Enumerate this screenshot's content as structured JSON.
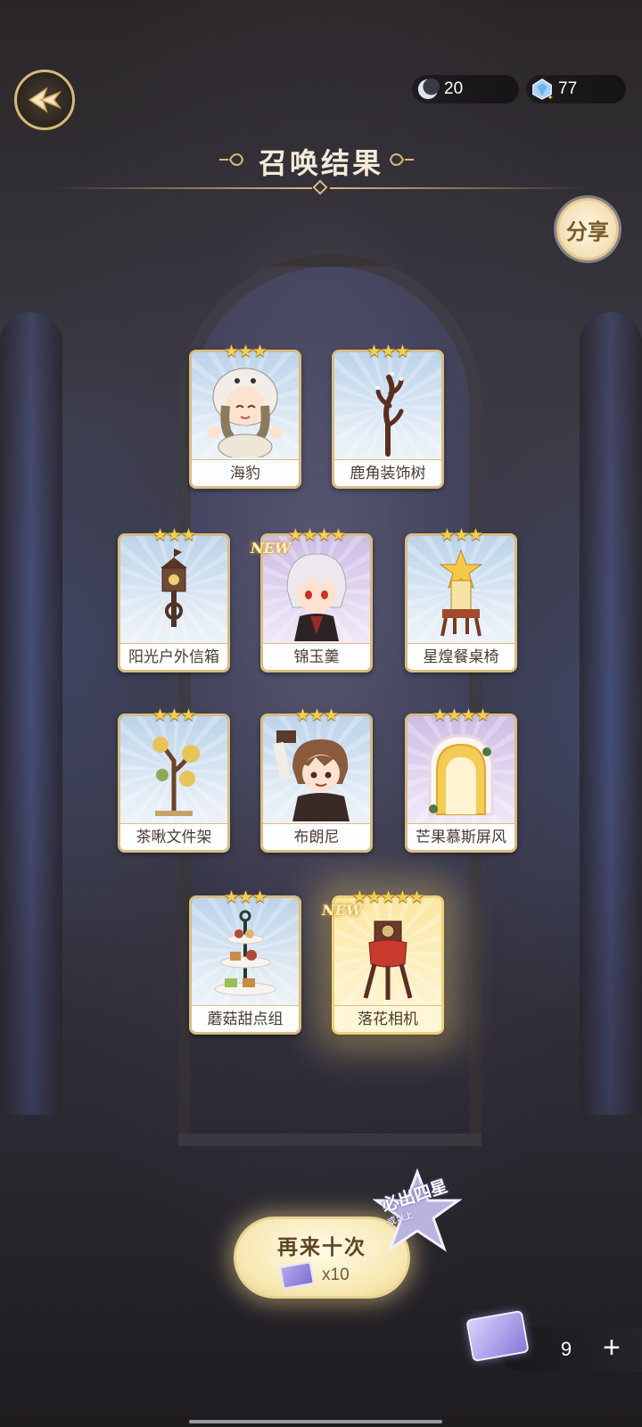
{
  "header": {
    "currencies": [
      {
        "icon": "moon-icon",
        "value": "20"
      },
      {
        "icon": "gem-icon",
        "value": "77"
      }
    ],
    "title": "召唤结果",
    "share_label": "分享"
  },
  "results": [
    {
      "name": "海豹",
      "stars": "★★★",
      "new": "",
      "theme": "blue",
      "art": "seal-character"
    },
    {
      "name": "鹿角装饰树",
      "stars": "★★★",
      "new": "",
      "theme": "blue",
      "art": "antler-tree"
    },
    {
      "name": "阳光户外信箱",
      "stars": "★★★",
      "new": "",
      "theme": "blue",
      "art": "mailbox"
    },
    {
      "name": "锦玉羹",
      "stars": "★★★★",
      "new": "NEW",
      "theme": "purple",
      "art": "white-hair-character"
    },
    {
      "name": "星煌餐桌椅",
      "stars": "★★★",
      "new": "",
      "theme": "blue",
      "art": "star-chair"
    },
    {
      "name": "茶啾文件架",
      "stars": "★★★",
      "new": "",
      "theme": "blue",
      "art": "file-rack-tree"
    },
    {
      "name": "布朗尼",
      "stars": "★★★",
      "new": "",
      "theme": "blue",
      "art": "brown-hair-character"
    },
    {
      "name": "芒果慕斯屏风",
      "stars": "★★★★",
      "new": "",
      "theme": "purple",
      "art": "mango-screen"
    },
    {
      "name": "蘑菇甜点组",
      "stars": "★★★",
      "new": "",
      "theme": "blue",
      "art": "dessert-stand"
    },
    {
      "name": "落花相机",
      "stars": "★★★★★",
      "new": "NEW",
      "theme": "gold",
      "art": "camera"
    }
  ],
  "footer": {
    "again_label": "再来十次",
    "again_cost": "x10",
    "badge_main": "必出四星",
    "badge_sub": "或以上",
    "ticket_count": "9",
    "plus": "+"
  },
  "colors": {
    "gold_border": "#d8bd82",
    "star": "#f4cf54",
    "title": "#f4ead8"
  }
}
